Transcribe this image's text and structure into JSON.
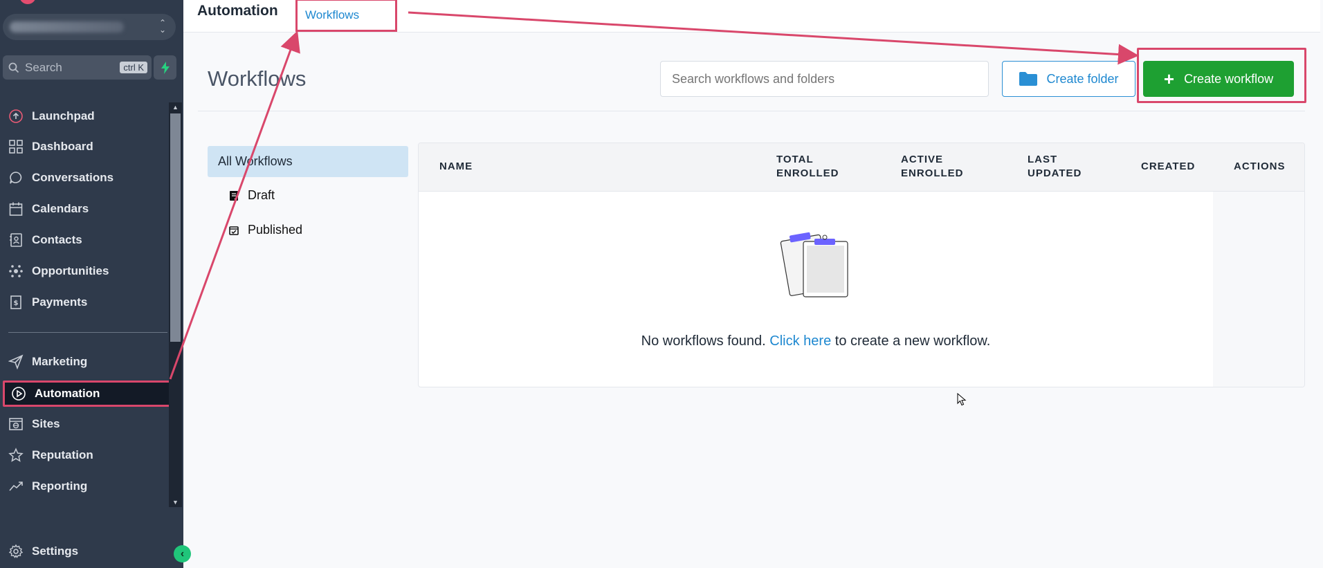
{
  "sidebar": {
    "search_placeholder": "Search",
    "search_shortcut": "ctrl K",
    "items": [
      {
        "label": "Launchpad",
        "icon": "launchpad-icon"
      },
      {
        "label": "Dashboard",
        "icon": "dashboard-icon"
      },
      {
        "label": "Conversations",
        "icon": "chat-icon"
      },
      {
        "label": "Calendars",
        "icon": "calendar-icon"
      },
      {
        "label": "Contacts",
        "icon": "contacts-icon"
      },
      {
        "label": "Opportunities",
        "icon": "opportunities-icon"
      },
      {
        "label": "Payments",
        "icon": "payments-icon"
      },
      {
        "label": "Marketing",
        "icon": "send-icon"
      },
      {
        "label": "Automation",
        "icon": "automation-icon",
        "active": true
      },
      {
        "label": "Sites",
        "icon": "sites-icon"
      },
      {
        "label": "Reputation",
        "icon": "star-icon"
      },
      {
        "label": "Reporting",
        "icon": "trend-icon"
      }
    ],
    "settings_label": "Settings"
  },
  "header": {
    "title": "Automation",
    "tab_label": "Workflows"
  },
  "main": {
    "page_title": "Workflows",
    "search_placeholder": "Search workflows and folders",
    "create_folder_label": "Create folder",
    "create_workflow_label": "Create workflow",
    "filters": {
      "all": "All Workflows",
      "draft": "Draft",
      "published": "Published"
    },
    "table": {
      "columns": {
        "name": "NAME",
        "total_enrolled": [
          "TOTAL",
          "ENROLLED"
        ],
        "active_enrolled": [
          "ACTIVE",
          "ENROLLED"
        ],
        "last_updated": [
          "LAST",
          "UPDATED"
        ],
        "created": "CREATED",
        "actions": "ACTIONS"
      },
      "empty": {
        "before": "No workflows found. ",
        "link": "Click here",
        "after": " to create a new workflow."
      }
    }
  },
  "colors": {
    "sidebar_bg": "#2f3a4b",
    "accent_blue": "#1e88d0",
    "create_green": "#1ea032",
    "annotation_red": "#d9476b"
  }
}
